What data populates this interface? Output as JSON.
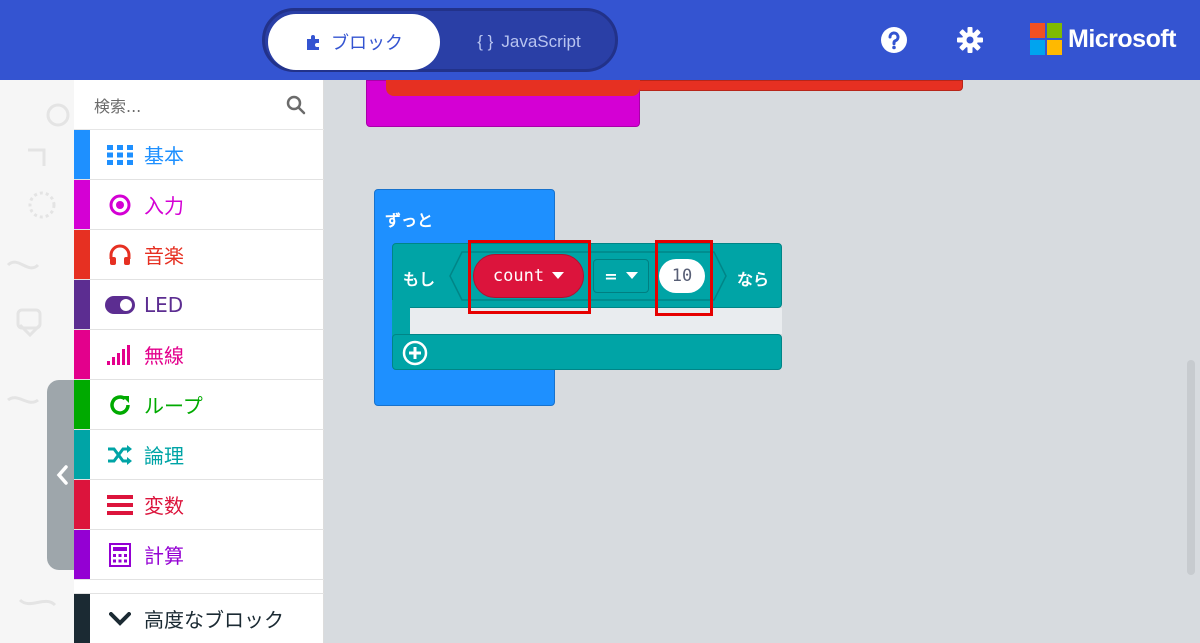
{
  "header": {
    "blocks_tab": "ブロック",
    "js_tab": "JavaScript",
    "js_tab_braces": "{ }",
    "brand": "Microsoft",
    "help_icon": "help-circle-icon",
    "settings_icon": "gear-icon",
    "colors": {
      "bar": "#3454d1"
    }
  },
  "toolbox": {
    "search_placeholder": "検索...",
    "categories": [
      {
        "label": "基本",
        "color": "#1e90ff",
        "icon": "grid-icon"
      },
      {
        "label": "入力",
        "color": "#d400d4",
        "icon": "target-icon"
      },
      {
        "label": "音楽",
        "color": "#e63022",
        "icon": "headphones-icon"
      },
      {
        "label": "LED",
        "color": "#5c2d91",
        "icon": "toggle-icon"
      },
      {
        "label": "無線",
        "color": "#e3008c",
        "icon": "signal-bars-icon"
      },
      {
        "label": "ループ",
        "color": "#00aa00",
        "icon": "refresh-icon"
      },
      {
        "label": "論理",
        "color": "#00a4a6",
        "icon": "shuffle-icon"
      },
      {
        "label": "変数",
        "color": "#dc143c",
        "icon": "list-lines-icon"
      },
      {
        "label": "計算",
        "color": "#9400d3",
        "icon": "calculator-icon"
      }
    ],
    "advanced": "高度なブロック"
  },
  "blocks": {
    "forever": "ずっと",
    "if": "もし",
    "variable": "count",
    "operator": "=",
    "value": "10",
    "then": "なら",
    "colors": {
      "forever": "#1e90ff",
      "logic": "#00a4a6",
      "variable": "#dc143c",
      "highlight": "#e60000"
    }
  }
}
